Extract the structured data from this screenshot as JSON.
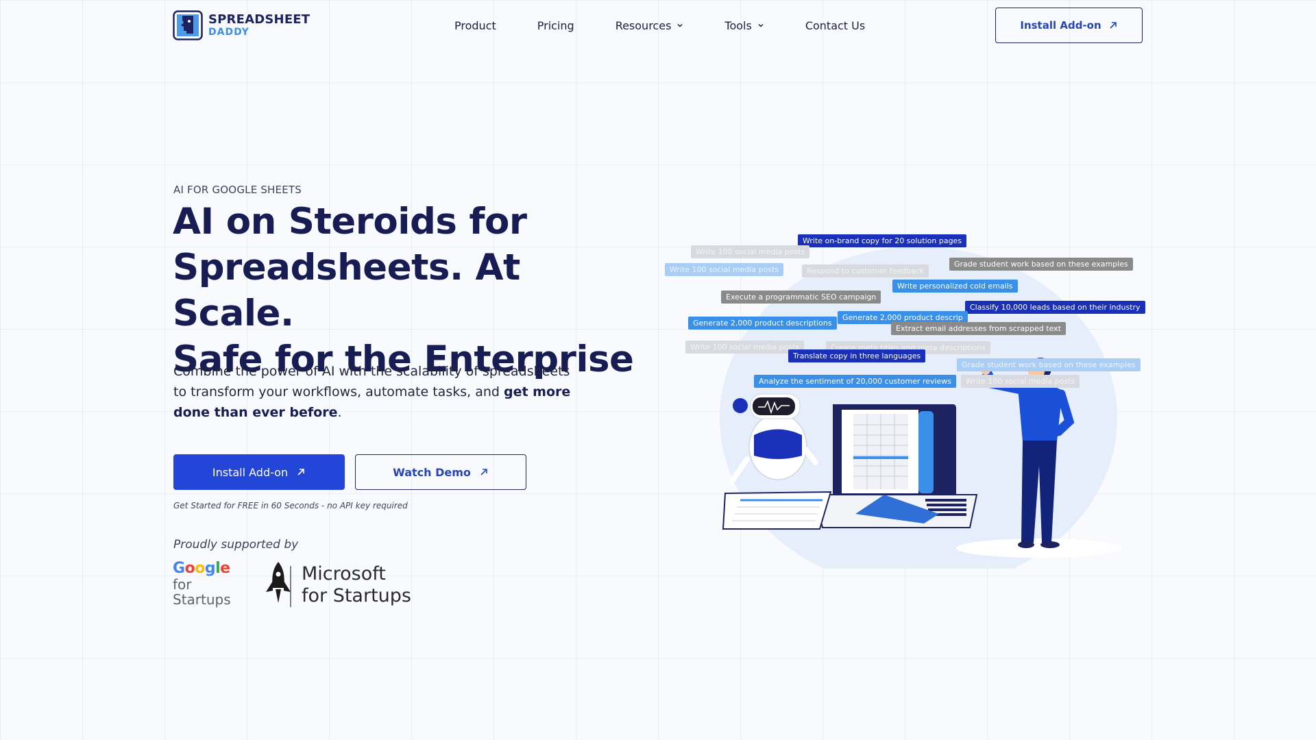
{
  "brand": {
    "line1": "SPREADSHEET",
    "line2": "DADDY"
  },
  "nav": {
    "items": [
      {
        "label": "Product"
      },
      {
        "label": "Pricing"
      },
      {
        "label": "Resources"
      },
      {
        "label": "Tools"
      },
      {
        "label": "Contact Us"
      }
    ],
    "install_label": "Install Add-on"
  },
  "hero": {
    "eyebrow": "AI FOR GOOGLE SHEETS",
    "headline_line1": "AI on Steroids for",
    "headline_line2": "Spreadsheets. At Scale.",
    "headline_line3": "Safe for the Enterprise",
    "sub_part1": "Combine the power of AI with the scalability of spreadsheets to transform your workflows, automate tasks, and ",
    "sub_bold": "get more done than ever before",
    "sub_end": ".",
    "primary_button": "Install Add-on",
    "secondary_button": "Watch Demo",
    "fine_print": "Get Started for FREE in 60 Seconds - no API key required",
    "supported_by": "Proudly supported by"
  },
  "partners": {
    "google_word": "Google",
    "google_sub1": "for",
    "google_sub2": "Startups",
    "ms_line1": "Microsoft",
    "ms_line2": "for Startups"
  },
  "illustration_tags": [
    "Write on-brand copy for 20 solution pages",
    "Write 100 social media posts",
    "Write 100 social media posts",
    "Respond to customer feedback",
    "Grade student work based on these examples",
    "Write personalized cold emails",
    "Execute a programmatic SEO campaign",
    "Classify 10,000 leads based on their industry",
    "Generate 2,000 product descriptions",
    "Generate 2,000 product descrip",
    "Extract email addresses from scrapped text",
    "Write 100 social media posts",
    "Create meta titles and meta descriptions",
    "Translate copy in three languages",
    "Grade student work based on these examples",
    "Analyze the sentiment of 20,000 customer reviews",
    "Write 100 social media posts"
  ],
  "colors": {
    "primary": "#2346d9",
    "navy": "#171c52",
    "accent_blue": "#3a8fe8"
  },
  "icons": [
    "logo-mark-icon",
    "chevron-down-icon",
    "arrow-up-right-icon",
    "rocket-icon"
  ]
}
